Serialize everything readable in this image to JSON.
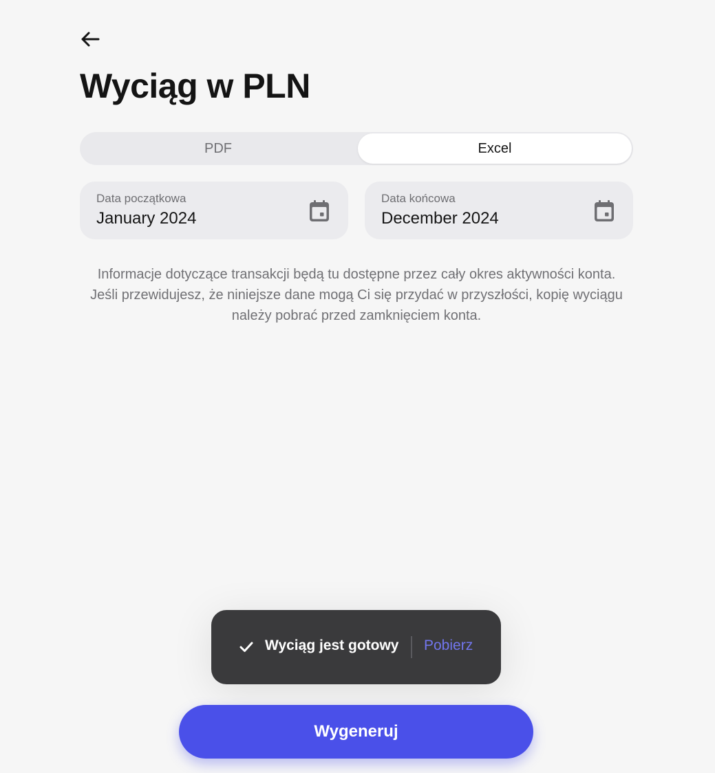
{
  "header": {
    "back_icon": "arrow-left-icon",
    "title": "Wyciąg w PLN"
  },
  "format_selector": {
    "options": [
      {
        "label": "PDF",
        "selected": false
      },
      {
        "label": "Excel",
        "selected": true
      }
    ]
  },
  "date_range": {
    "start": {
      "label": "Data początkowa",
      "value": "January 2024",
      "icon": "calendar-icon"
    },
    "end": {
      "label": "Data końcowa",
      "value": "December 2024",
      "icon": "calendar-icon"
    }
  },
  "info_text": "Informacje dotyczące transakcji będą tu dostępne przez cały okres aktywności konta. Jeśli przewidujesz, że niniejsze dane mogą Ci się przydać w przyszłości, kopię wyciągu należy pobrać przed zamknięciem konta.",
  "toast": {
    "icon": "check-icon",
    "message": "Wyciąg jest gotowy",
    "action_label": "Pobierz"
  },
  "primary_action": {
    "label": "Wygeneruj"
  },
  "colors": {
    "background": "#f6f6f6",
    "accent": "#4a50e9",
    "toast_bg": "#3a3a3c",
    "toast_link": "#7276ee",
    "field_bg": "#ebebee"
  }
}
